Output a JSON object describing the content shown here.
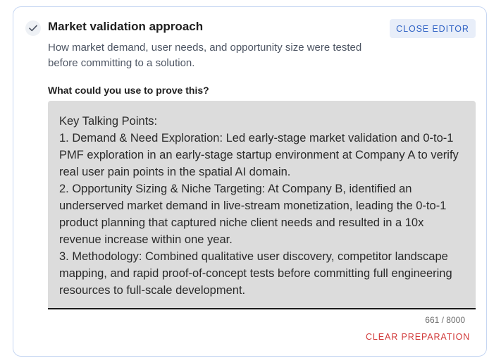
{
  "card": {
    "title": "Market validation approach",
    "subtitle": "How market demand, user needs, and opportunity size were tested before committing to a solution.",
    "close_button_label": "CLOSE EDITOR",
    "status_icon": "check-icon"
  },
  "editor": {
    "prompt_label": "What could you use to prove this?",
    "value": "Key Talking Points:\n1. Demand & Need Exploration: Led early-stage market validation and 0-to-1 PMF exploration in an early-stage startup environment at Company A to verify real user pain points in the spatial AI domain.\n2. Opportunity Sizing & Niche Targeting: At Company B, identified an underserved market demand in live-stream monetization, leading the 0-to-1 product planning that captured niche client needs and resulted in a 10x revenue increase within one year.\n3. Methodology: Combined qualitative user discovery, competitor landscape mapping, and rapid proof-of-concept tests before committing full engineering resources to full-scale development.",
    "char_count": "661 / 8000",
    "clear_button_label": "CLEAR PREPARATION"
  },
  "colors": {
    "accent_blue": "#2f62c4",
    "danger_red": "#d23a3a",
    "card_border": "#c6d6f2",
    "editor_background": "#dcdcdc"
  }
}
